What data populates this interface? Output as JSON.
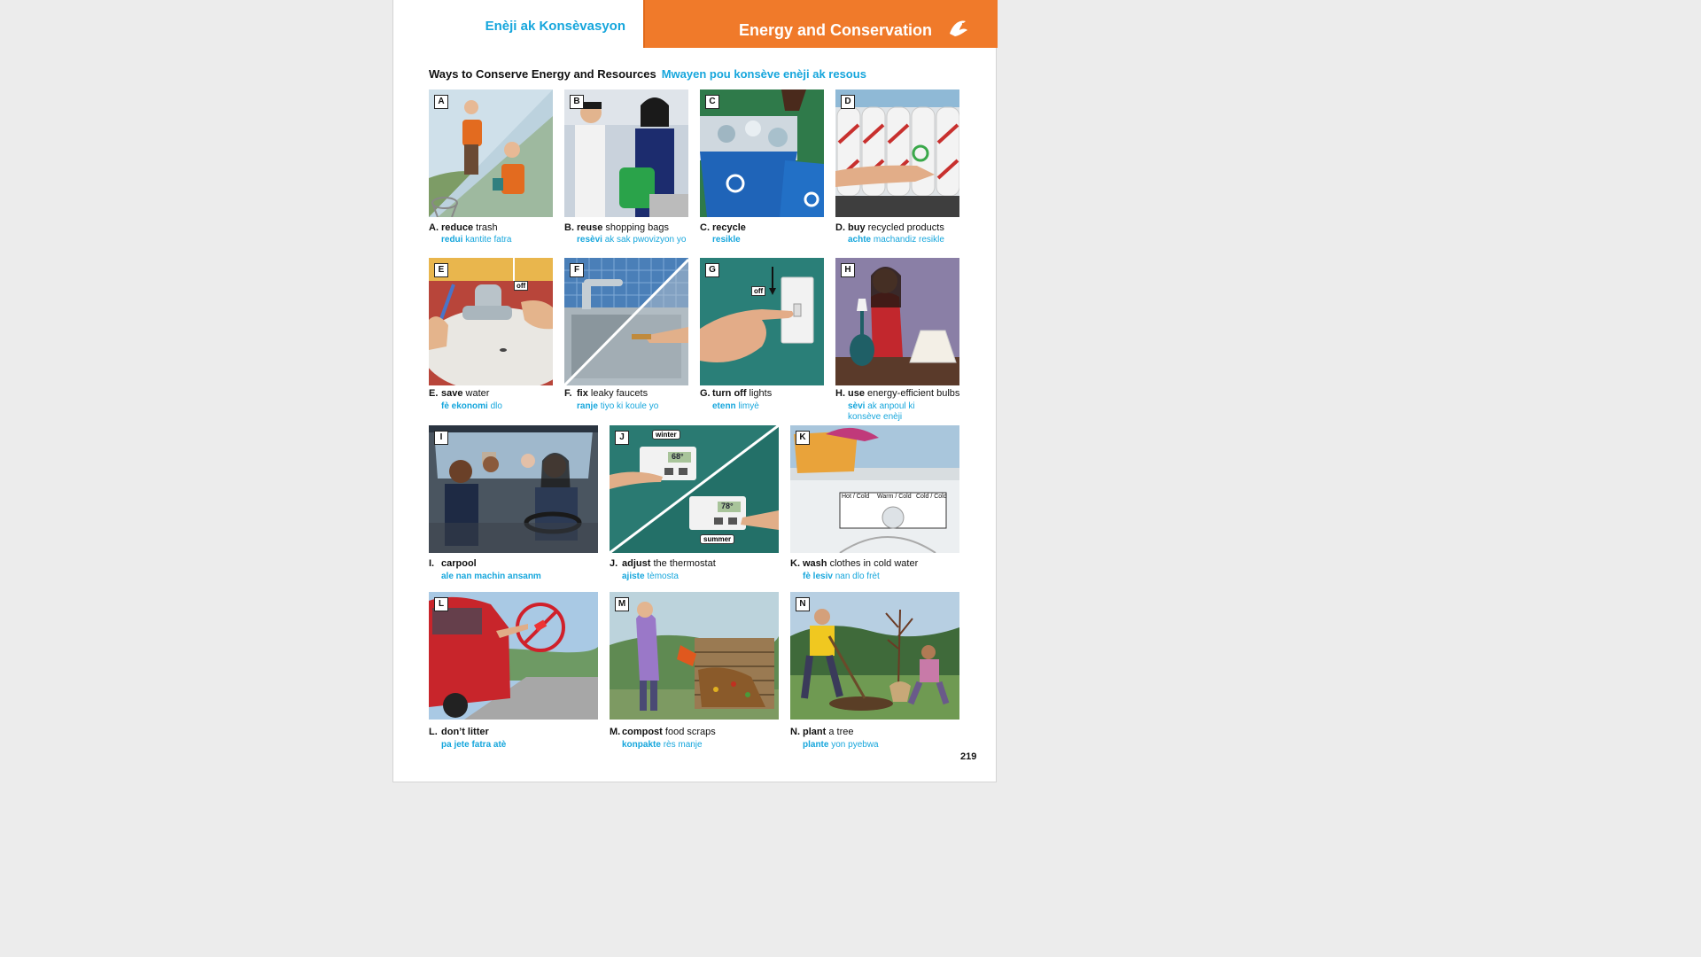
{
  "header": {
    "haitian_title": "Enèji ak Konsèvasyon",
    "english_title": "Energy and Conservation",
    "accent_color": "#f07a2a",
    "haitian_color": "#16a6dc"
  },
  "section": {
    "title": "Ways to Conserve Energy and Resources",
    "title_ht": "Mwayen pou konsève enèji ak resous"
  },
  "items": [
    {
      "letter": "A",
      "prefix": "A.",
      "verb": "reduce",
      "rest": "trash",
      "ht_verb": "redui",
      "ht_rest": "kantite fatra"
    },
    {
      "letter": "B",
      "prefix": "B.",
      "verb": "reuse",
      "rest": "shopping bags",
      "ht_verb": "resèvi",
      "ht_rest": "ak sak pwovizyon yo"
    },
    {
      "letter": "C",
      "prefix": "C.",
      "verb": "recycle",
      "rest": "",
      "ht_verb": "resikle",
      "ht_rest": ""
    },
    {
      "letter": "D",
      "prefix": "D.",
      "verb": "buy",
      "rest": "recycled products",
      "ht_verb": "achte",
      "ht_rest": "machandiz resikle"
    },
    {
      "letter": "E",
      "prefix": "E.",
      "verb": "save",
      "rest": "water",
      "ht_verb": "fè ekonomi",
      "ht_rest": "dlo",
      "tag": "off"
    },
    {
      "letter": "F",
      "prefix": "F.",
      "verb": "fix",
      "rest": "leaky faucets",
      "ht_verb": "ranje",
      "ht_rest": "tiyo ki koule yo"
    },
    {
      "letter": "G",
      "prefix": "G.",
      "verb": "turn off",
      "rest": "lights",
      "ht_verb": "etenn",
      "ht_rest": "limyè",
      "tag": "off"
    },
    {
      "letter": "H",
      "prefix": "H.",
      "verb": "use",
      "rest": "energy-efficient bulbs",
      "ht_verb": "sèvi",
      "ht_rest": "ak anpoul ki",
      "ht_line2": "konsève enèji"
    },
    {
      "letter": "I",
      "prefix": "I.",
      "verb": "carpool",
      "rest": "",
      "ht_verb": "ale nan machin ansanm",
      "ht_rest": ""
    },
    {
      "letter": "J",
      "prefix": "J.",
      "verb": "adjust",
      "rest": "the thermostat",
      "ht_verb": "ajiste",
      "ht_rest": "tèmosta",
      "winter": "winter",
      "summer": "summer",
      "temp_winter": "68°",
      "temp_summer": "78°"
    },
    {
      "letter": "K",
      "prefix": "K.",
      "verb": "wash",
      "rest": "clothes in cold water",
      "ht_verb": "fè lesiv",
      "ht_rest": "nan dlo frèt",
      "dial1": "Hot / Cold",
      "dial2": "Warm / Cold",
      "dial3": "Cold / Cold"
    },
    {
      "letter": "L",
      "prefix": "L.",
      "verb": "don’t litter",
      "rest": "",
      "ht_verb": "pa jete fatra atè",
      "ht_rest": ""
    },
    {
      "letter": "M",
      "prefix": "M.",
      "verb": "compost",
      "rest": "food scraps",
      "ht_verb": "konpakte",
      "ht_rest": "rès manje"
    },
    {
      "letter": "N",
      "prefix": "N.",
      "verb": "plant",
      "rest": "a tree",
      "ht_verb": "plante",
      "ht_rest": "yon pyebwa"
    }
  ],
  "page_number": "219"
}
